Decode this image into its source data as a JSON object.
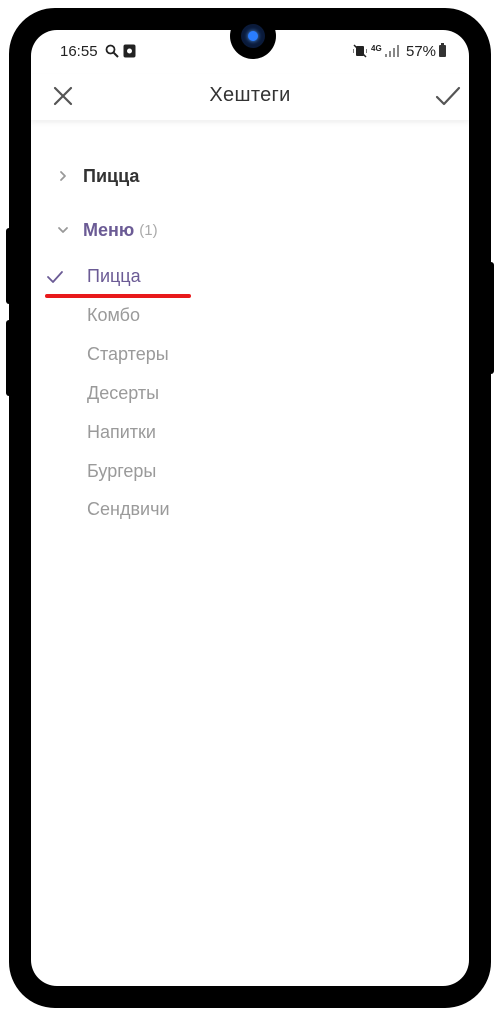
{
  "status_bar": {
    "time": "16:55",
    "network": "4G",
    "battery_percent": "57%"
  },
  "header": {
    "title": "Хештеги",
    "close_icon": "close-icon",
    "confirm_icon": "checkmark-icon"
  },
  "tree": {
    "groups": [
      {
        "label": "Пицца",
        "expanded": false,
        "count": ""
      },
      {
        "label": "Меню",
        "expanded": true,
        "count": "(1)"
      }
    ],
    "items": [
      {
        "label": "Пицца",
        "selected": true
      },
      {
        "label": "Комбо",
        "selected": false
      },
      {
        "label": "Стартеры",
        "selected": false
      },
      {
        "label": "Десерты",
        "selected": false
      },
      {
        "label": "Напитки",
        "selected": false
      },
      {
        "label": "Бургеры",
        "selected": false
      },
      {
        "label": "Сендвичи",
        "selected": false
      }
    ]
  },
  "colors": {
    "accent": "#6b5b95",
    "annotation_underline": "#e8191b",
    "muted_text": "#9a9a9a"
  }
}
